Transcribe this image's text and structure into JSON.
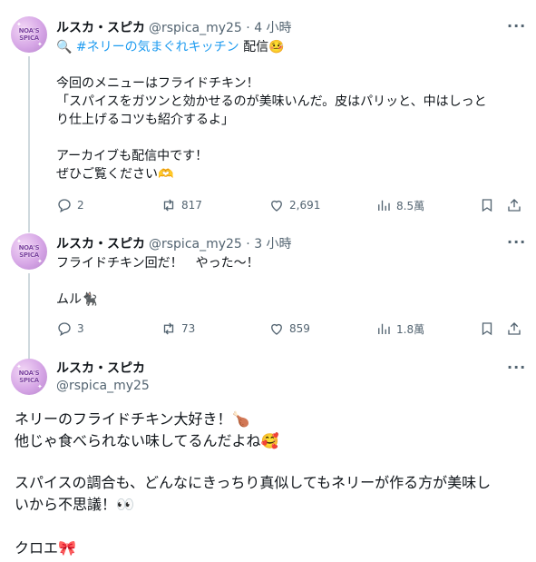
{
  "tweets": [
    {
      "name": "ルスカ・スピカ",
      "handle": "@rspica_my25 · 4 小時",
      "avatar_text": "NOA'S SPICA",
      "line1_icon": "🔍",
      "hashtag": "#ネリーの気まぐれキッチン",
      "line1_tail": " 配信",
      "line1_emoji": "🤒",
      "body": [
        "今回のメニューはフライドチキン！",
        "「スパイスをガツンと効かせるのが美味いんだ。皮はパリッと、中はしっと",
        "り仕上げるコツも紹介するよ」",
        "アーカイブも配信中です！",
        "ぜひご覧ください"
      ],
      "body_end_emoji": "🫶",
      "replies": "2",
      "retweets": "817",
      "likes": "2,691",
      "views": "8.5萬"
    },
    {
      "name": "ルスカ・スピカ",
      "handle": "@rspica_my25 · 3 小時",
      "avatar_text": "NOA'S SPICA",
      "body": [
        "フライドチキン回だ！　やった〜！",
        "ムル"
      ],
      "body_end_emoji": "🐈‍⬛",
      "replies": "3",
      "retweets": "73",
      "likes": "859",
      "views": "1.8萬"
    },
    {
      "name": "ルスカ・スピカ",
      "handle": "@rspica_my25",
      "avatar_text": "NOA'S SPICA",
      "body": [
        "ネリーのフライドチキン大好き！",
        "他じゃ食べられない味してるんだよね",
        "スパイスの調合も、どんなにきっちり真似してもネリーが作る方が美味し",
        "いから不思議！",
        "クロエ"
      ],
      "emojis": [
        "🍗",
        "🥰",
        "👀",
        "🎀"
      ]
    }
  ],
  "more_label": "···",
  "colors": {
    "link": "#1d9bf0",
    "muted": "#536471",
    "line": "#cfd9de"
  }
}
